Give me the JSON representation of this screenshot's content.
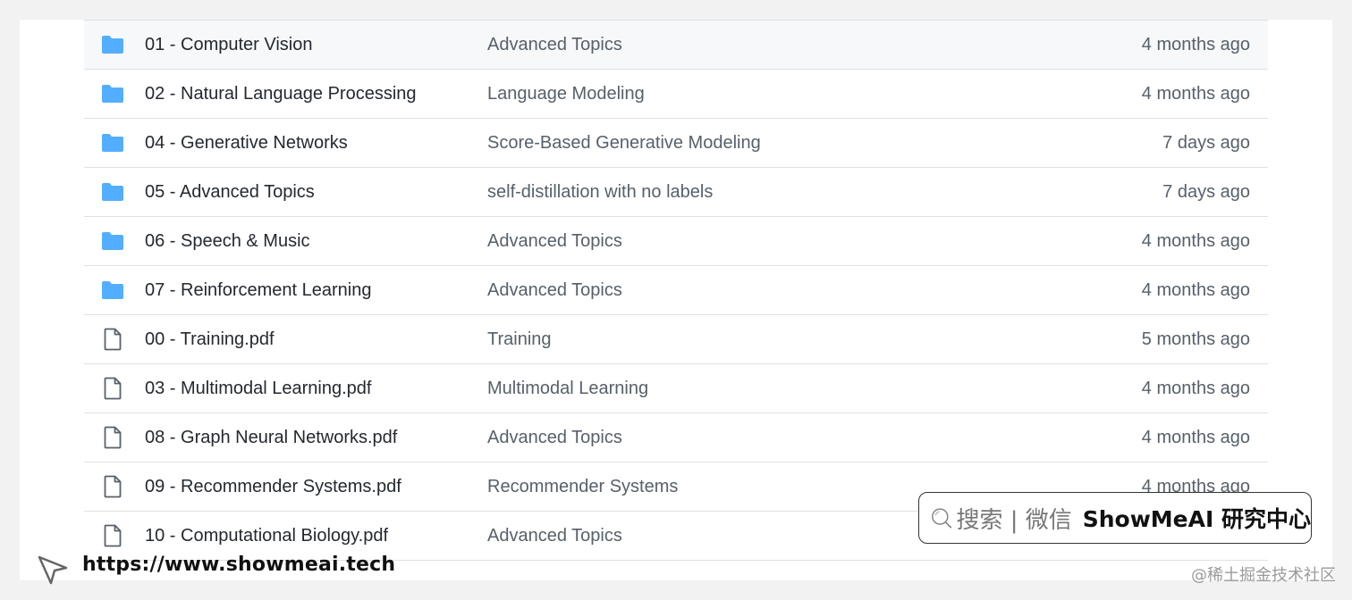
{
  "colors": {
    "folder": "#54aeff",
    "file_stroke": "#57606a",
    "text_primary": "#24292f",
    "text_secondary": "#57606a",
    "border": "#dde1e5"
  },
  "rows": [
    {
      "type": "folder",
      "icon": "folder-icon",
      "name": "01 - Computer Vision",
      "message": "Advanced Topics",
      "age": "4 months ago"
    },
    {
      "type": "folder",
      "icon": "folder-icon",
      "name": "02 - Natural Language Processing",
      "message": "Language Modeling",
      "age": "4 months ago"
    },
    {
      "type": "folder",
      "icon": "folder-icon",
      "name": "04 - Generative Networks",
      "message": "Score-Based Generative Modeling",
      "age": "7 days ago"
    },
    {
      "type": "folder",
      "icon": "folder-icon",
      "name": "05 - Advanced Topics",
      "message": "self-distillation with no labels",
      "age": "7 days ago"
    },
    {
      "type": "folder",
      "icon": "folder-icon",
      "name": "06 - Speech & Music",
      "message": "Advanced Topics",
      "age": "4 months ago"
    },
    {
      "type": "folder",
      "icon": "folder-icon",
      "name": "07 - Reinforcement Learning",
      "message": "Advanced Topics",
      "age": "4 months ago"
    },
    {
      "type": "file",
      "icon": "file-icon",
      "name": "00 - Training.pdf",
      "message": "Training",
      "age": "5 months ago"
    },
    {
      "type": "file",
      "icon": "file-icon",
      "name": "03 - Multimodal Learning.pdf",
      "message": "Multimodal Learning",
      "age": "4 months ago"
    },
    {
      "type": "file",
      "icon": "file-icon",
      "name": "08 - Graph Neural Networks.pdf",
      "message": "Advanced Topics",
      "age": "4 months ago"
    },
    {
      "type": "file",
      "icon": "file-icon",
      "name": "09 - Recommender Systems.pdf",
      "message": "Recommender Systems",
      "age": "4 months ago"
    },
    {
      "type": "file",
      "icon": "file-icon",
      "name": "10 - Computational Biology.pdf",
      "message": "Advanced Topics",
      "age": ""
    }
  ],
  "overlay": {
    "url": "https://www.showmeai.tech",
    "search_text": "搜索 | 微信",
    "search_bold": "ShowMeAI 研究中心",
    "watermark": "@稀土掘金技术社区"
  }
}
